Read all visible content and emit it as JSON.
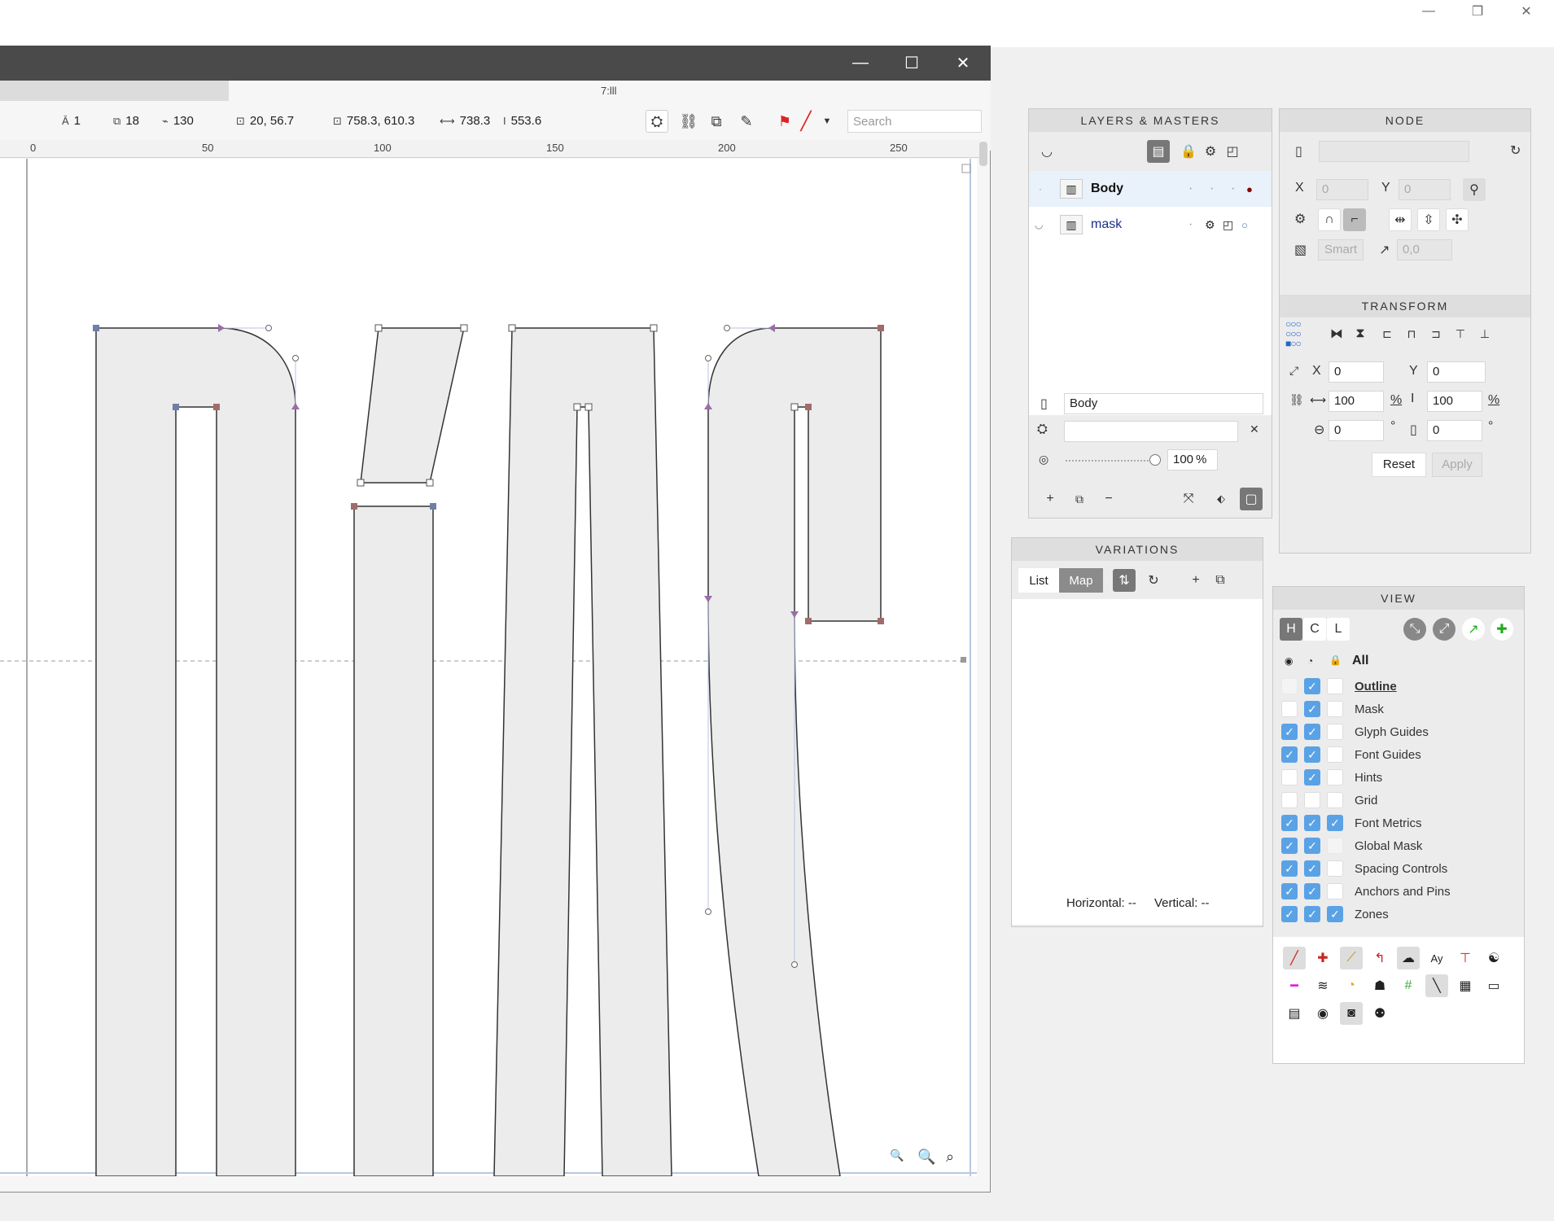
{
  "app": {
    "window_controls": [
      "—",
      "❐",
      "✕"
    ]
  },
  "glyph_window": {
    "controls": [
      "—",
      "☐",
      "✕"
    ],
    "tab_label": "7:lll",
    "stats": [
      {
        "icon": "Ā",
        "value": "1"
      },
      {
        "icon": "⧉",
        "value": "18"
      },
      {
        "icon": "⌁",
        "value": "130"
      },
      {
        "icon": "⊡",
        "value": "20, 56.7"
      },
      {
        "icon": "⊡",
        "value": "758.3, 610.3"
      },
      {
        "icon": "⟷",
        "value": "738.3"
      },
      {
        "icon": "I",
        "value": "553.6"
      }
    ],
    "search_placeholder": "Search",
    "ruler_labels": [
      "0",
      "50",
      "100",
      "150",
      "200",
      "250"
    ],
    "zoom_icons": [
      "🔍",
      "🔍",
      "⌕"
    ]
  },
  "layers": {
    "title": "LAYERS & MASTERS",
    "rows": [
      {
        "name": "Body",
        "active": true
      },
      {
        "name": "mask",
        "active": false
      }
    ],
    "layer_name_value": "Body",
    "opacity": "100",
    "opacity_unit": "%"
  },
  "node": {
    "title": "NODE",
    "x_label": "X",
    "x_value": "0",
    "y_label": "Y",
    "y_value": "0",
    "smart_label": "Smart",
    "coords_value": "0,0"
  },
  "transform": {
    "title": "TRANSFORM",
    "x_label": "X",
    "x_value": "0",
    "y_label": "Y",
    "y_value": "0",
    "w_value": "100",
    "h_value": "100",
    "percent": "%",
    "rot_value": "0",
    "slant_value": "0",
    "degree": "°",
    "reset_label": "Reset",
    "apply_label": "Apply"
  },
  "variations": {
    "title": "VARIATIONS",
    "list_tab": "List",
    "map_tab": "Map",
    "horizontal": "Horizontal: --",
    "vertical": "Vertical: --"
  },
  "view": {
    "title": "VIEW",
    "modes": [
      "H",
      "C",
      "L"
    ],
    "all_label": "All",
    "rows": [
      {
        "label": "Outline",
        "c1": "faint",
        "c2": "on",
        "c3": "off",
        "bold": true
      },
      {
        "label": "Mask",
        "c1": "off",
        "c2": "on",
        "c3": "off"
      },
      {
        "label": "Glyph Guides",
        "c1": "on",
        "c2": "on",
        "c3": "off"
      },
      {
        "label": "Font Guides",
        "c1": "on",
        "c2": "on",
        "c3": "off"
      },
      {
        "label": "Hints",
        "c1": "off",
        "c2": "on",
        "c3": "off"
      },
      {
        "label": "Grid",
        "c1": "off",
        "c2": "off",
        "c3": "off"
      },
      {
        "label": "Font Metrics",
        "c1": "on",
        "c2": "on",
        "c3": "on"
      },
      {
        "label": "Global Mask",
        "c1": "on",
        "c2": "on",
        "c3": "faint"
      },
      {
        "label": "Spacing Controls",
        "c1": "on",
        "c2": "on",
        "c3": "off"
      },
      {
        "label": "Anchors and Pins",
        "c1": "on",
        "c2": "on",
        "c3": "off"
      },
      {
        "label": "Zones",
        "c1": "on",
        "c2": "on",
        "c3": "on"
      }
    ]
  },
  "colors": {
    "accent": "#5aa2e6",
    "title_bar": "#4a4a4a",
    "glyph_fill": "#ececec",
    "node_blue": "#6f7fa8",
    "node_red": "#a26b6b",
    "handle_purple": "#9a6ea8"
  }
}
